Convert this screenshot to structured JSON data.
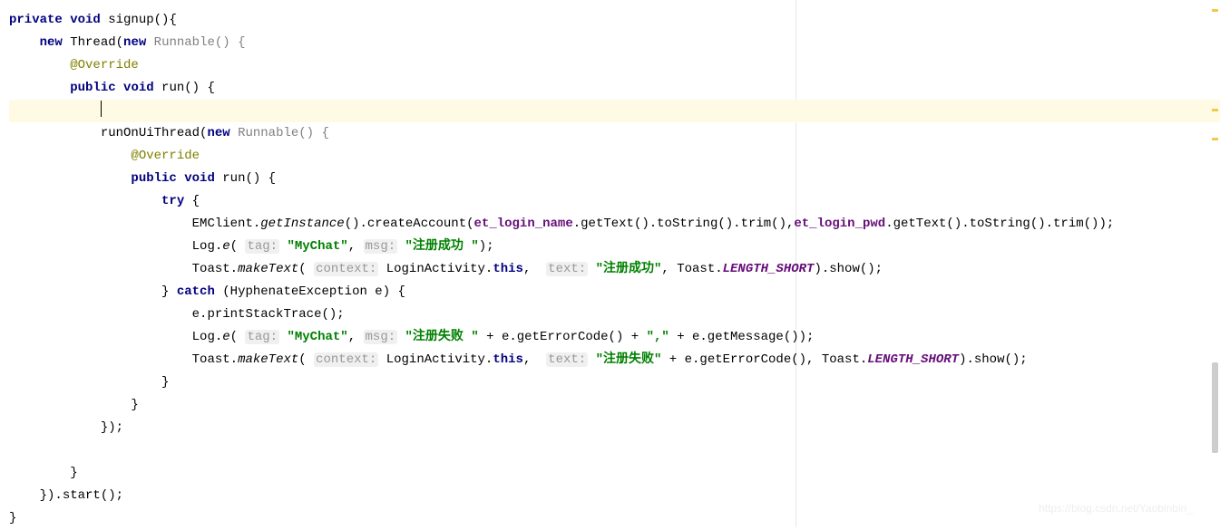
{
  "code": {
    "l1_private": "private",
    "l1_void": "void",
    "l1_method": " signup(){",
    "l2_new": "new",
    "l2_thread": " Thread(",
    "l2_new2": "new",
    "l2_runnable": " Runnable() {",
    "l3_override": "@Override",
    "l4_public": "public",
    "l4_void": "void",
    "l4_run": " run() {",
    "l6_runon": "runOnUiThread(",
    "l6_new": "new",
    "l6_runnable": " Runnable() {",
    "l7_override": "@Override",
    "l8_public": "public",
    "l8_void": "void",
    "l8_run": " run() {",
    "l9_try": "try",
    "l9_brace": " {",
    "l10_emclient": "EMClient.",
    "l10_getinstance": "getInstance",
    "l10_create": "().createAccount(",
    "l10_et1": "et_login_name",
    "l10_gettext1": ".getText().toString().trim(),",
    "l10_et2": "et_login_pwd",
    "l10_gettext2": ".getText().toString().trim());",
    "l11_log": "Log.",
    "l11_e": "e",
    "l11_open": "( ",
    "l11_taghint": "tag:",
    "l11_tag": " \"MyChat\"",
    "l11_comma": ", ",
    "l11_msghint": "msg:",
    "l11_msg": " \"注册成功 \"",
    "l11_close": ");",
    "l12_toast": "Toast.",
    "l12_maketext": "makeText",
    "l12_open": "( ",
    "l12_ctxhint": "context:",
    "l12_ctx": " LoginActivity.",
    "l12_this": "this",
    "l12_comma1": ",  ",
    "l12_texthint": "text:",
    "l12_text": " \"注册成功\"",
    "l12_comma2": ", Toast.",
    "l12_length": "LENGTH_SHORT",
    "l12_show": ").show();",
    "l13_close": "} ",
    "l13_catch": "catch",
    "l13_exc": " (HyphenateException e) {",
    "l14_print": "e.printStackTrace();",
    "l15_log": "Log.",
    "l15_e": "e",
    "l15_open": "( ",
    "l15_taghint": "tag:",
    "l15_tag": " \"MyChat\"",
    "l15_comma": ", ",
    "l15_msghint": "msg:",
    "l15_msg": " \"注册失败 \"",
    "l15_plus": " + e.getErrorCode() + ",
    "l15_comma2": "\",\"",
    "l15_plus2": " + e.getMessage());",
    "l16_toast": "Toast.",
    "l16_maketext": "makeText",
    "l16_open": "( ",
    "l16_ctxhint": "context:",
    "l16_ctx": " LoginActivity.",
    "l16_this": "this",
    "l16_comma1": ",  ",
    "l16_texthint": "text:",
    "l16_text": " \"注册失败\"",
    "l16_plus": " + e.getErrorCode(), Toast.",
    "l16_length": "LENGTH_SHORT",
    "l16_show": ").show();",
    "l17_close": "}",
    "l18_close": "}",
    "l19_close": "});",
    "l21_close": "}",
    "l22_close": "}).start();",
    "l23_close": "}"
  },
  "watermark": "https://blog.csdn.net/Yaobinbin_"
}
